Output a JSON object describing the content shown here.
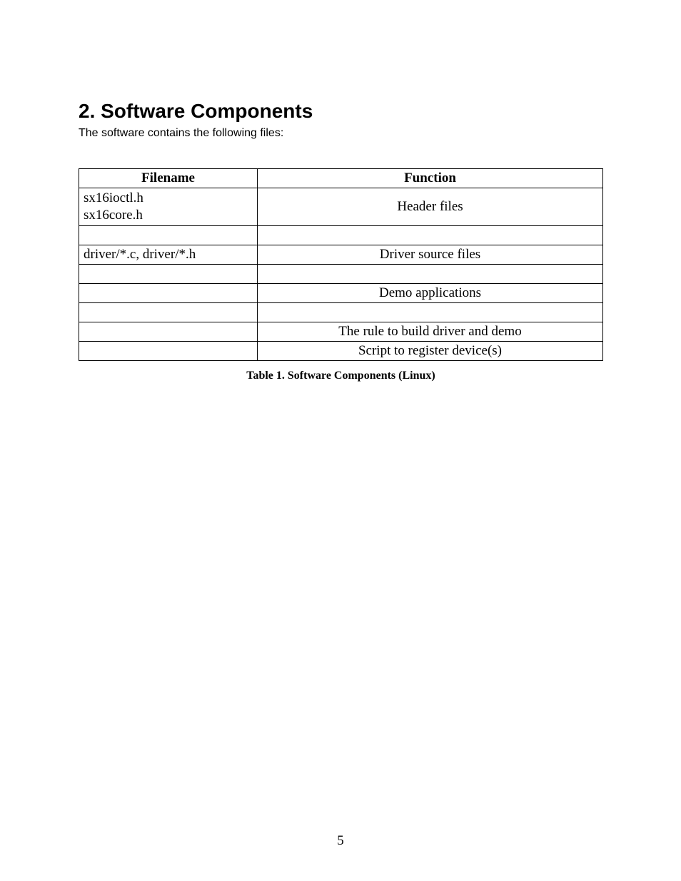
{
  "heading": "2. Software Components",
  "intro": "The software contains the following files:",
  "table": {
    "head": {
      "filename": "Filename",
      "function": "Function"
    },
    "rows": [
      {
        "filename_lines": [
          "sx16ioctl.h",
          "sx16core.h"
        ],
        "function": "Header files"
      },
      {
        "filename_lines": [
          ""
        ],
        "function": ""
      },
      {
        "filename_lines": [
          "driver/*.c, driver/*.h"
        ],
        "function": "Driver source files"
      },
      {
        "filename_lines": [
          ""
        ],
        "function": ""
      },
      {
        "filename_lines": [
          ""
        ],
        "function": "Demo applications"
      },
      {
        "filename_lines": [
          ""
        ],
        "function": ""
      },
      {
        "filename_lines": [
          ""
        ],
        "function": "The rule to build driver and demo"
      },
      {
        "filename_lines": [
          ""
        ],
        "function": "Script to register device(s)"
      }
    ]
  },
  "caption": "Table 1.  Software Components (Linux)",
  "page_number": "5"
}
